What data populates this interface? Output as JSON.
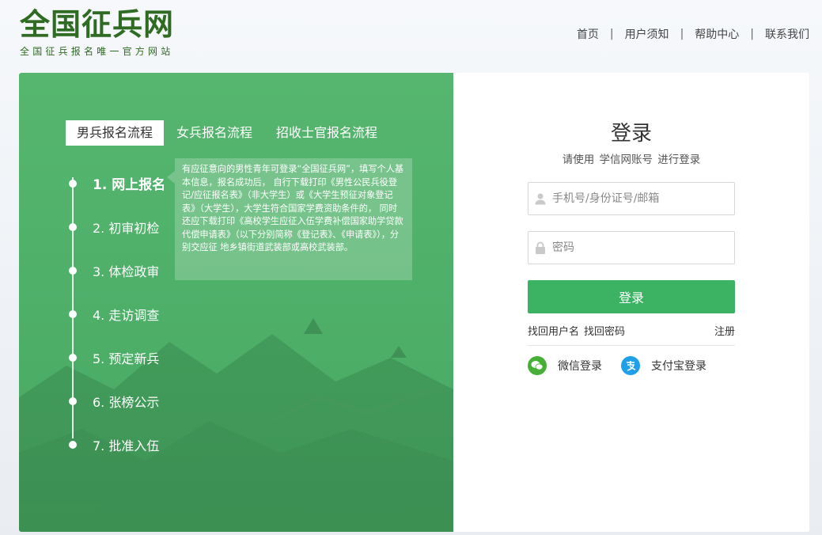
{
  "logo": {
    "title": "全国征兵网",
    "subtitle": "全国征兵报名唯一官方网站"
  },
  "nav": {
    "items": [
      "首页",
      "用户须知",
      "帮助中心",
      "联系我们"
    ],
    "separator": "|"
  },
  "tabs": [
    "男兵报名流程",
    "女兵报名流程",
    "招收士官报名流程"
  ],
  "active_tab": "男兵报名流程",
  "steps": [
    "1. 网上报名",
    "2. 初审初检",
    "3. 体检政审",
    "4. 走访调查",
    "5. 预定新兵",
    "6. 张榜公示",
    "7. 批准入伍"
  ],
  "tip": "有应征意向的男性青年可登录“全国征兵网”，填写个人基本信息，报名成功后， 自行下载打印《男性公民兵役登记/应征报名表》（非大学生）或《大学生预征对象登记表》（大学生），大学生符合国家学费资助条件的， 同时还应下载打印《高校学生应征入伍学费补偿国家助学贷款代偿申请表》（以下分别简称《登记表》、《申请表》），分别交应征 地乡镇街道武装部或高校武装部。",
  "login": {
    "title": "登录",
    "subtitle": "请使用  学信网账号  进行登录",
    "username_placeholder": "手机号/身份证号/邮箱",
    "password_placeholder": "密码",
    "button": "登录",
    "find_username": "找回用户名",
    "find_password": "找回密码",
    "register": "注册",
    "wechat": "微信登录",
    "alipay": "支付宝登录"
  },
  "colors": {
    "brand_green": "#2f6b23",
    "panel_green": "#52b46d",
    "button_green": "#3cb362",
    "wechat": "#45b035",
    "alipay": "#1fa0e8"
  }
}
